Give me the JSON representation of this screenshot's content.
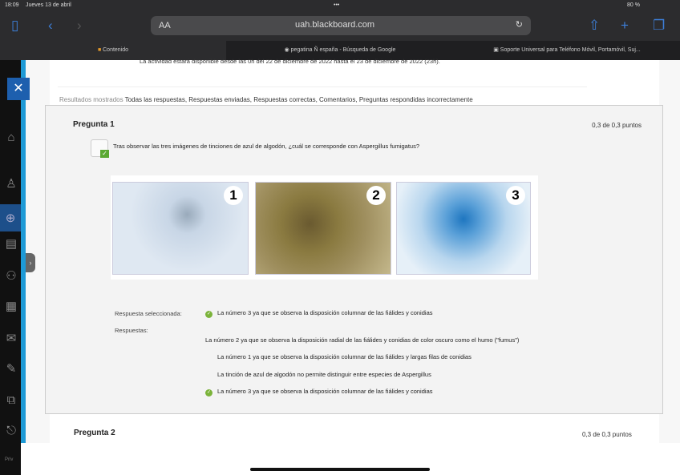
{
  "status": {
    "time": "18:09",
    "date": "Jueves 13 de abril",
    "dots": "•••",
    "battery": "80 %"
  },
  "browser": {
    "text_size": "AA",
    "url": "uah.blackboard.com"
  },
  "tabs": [
    {
      "label": "Contenido"
    },
    {
      "label": "pegatina Ñ españa - Búsqueda de Google"
    },
    {
      "label": "Soporte Universal para Teléfono Móvil, Portamóvil, Suj..."
    }
  ],
  "page": {
    "availability": "La actividad estará disponible desde las 0h del 22 de diciembre de 2022 hasta el 23 de diciembre de 2022 (23h).",
    "results_label": "Resultados mostrados",
    "results_value": "Todas las respuestas, Respuestas enviadas, Respuestas correctas, Comentarios, Preguntas respondidas incorrectamente",
    "question1": {
      "title": "Pregunta 1",
      "score": "0,3 de 0,3 puntos",
      "text": "Tras observar las tres imágenes de tinciones de azul de algodón, ¿cuál se corresponde con Aspergillus fumigatus?",
      "images": [
        "1",
        "2",
        "3"
      ],
      "selected_label": "Respuesta seleccionada:",
      "selected": "La número 3  ya que se observa la disposición columnar de las fiálides y conidias",
      "answers_label": "Respuestas:",
      "answers": [
        "La número 2  ya que se observa la disposición radial de las fiálides y conidias de color oscuro como el humo (\"fumus\")",
        "La número 1  ya que se observa la disposición columnar de las fiálides y largas filas de conidias",
        "La tinción de azul de algodón no permite distinguir entre especies de Aspergillus",
        "La número 3  ya que se observa la disposición columnar de las fiálides y conidias"
      ]
    },
    "question2": {
      "title": "Pregunta 2",
      "score": "0,3 de 0,3 puntos"
    }
  },
  "sidebar": {
    "footer": "Priv"
  }
}
